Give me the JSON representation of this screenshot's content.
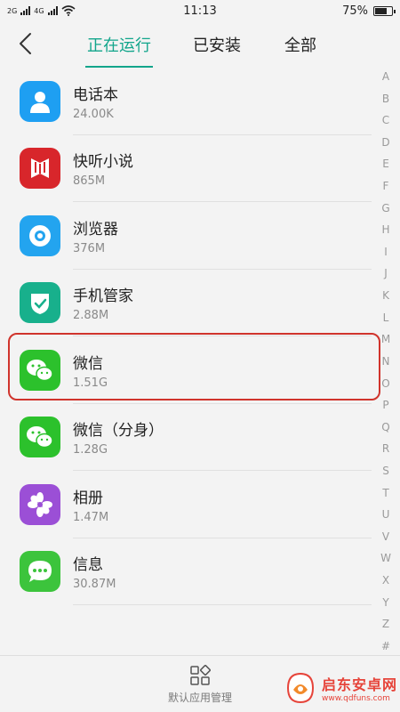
{
  "status_bar": {
    "network1": "2G",
    "network2": "4G",
    "time": "11:13",
    "battery": "75%",
    "battery_level": 0.75
  },
  "header": {
    "tabs": [
      {
        "label": "正在运行",
        "active": true
      },
      {
        "label": "已安装",
        "active": false
      },
      {
        "label": "全部",
        "active": false
      }
    ]
  },
  "apps": [
    {
      "name": "电话本",
      "size": "24.00K",
      "icon": "contacts-icon",
      "color": "#1e9ff2"
    },
    {
      "name": "快听小说",
      "size": "865M",
      "icon": "book-icon",
      "color": "#d8262b"
    },
    {
      "name": "浏览器",
      "size": "376M",
      "icon": "browser-icon",
      "color": "#23a4ef"
    },
    {
      "name": "手机管家",
      "size": "2.88M",
      "icon": "shield-icon",
      "color": "#18b08c"
    },
    {
      "name": "微信",
      "size": "1.51G",
      "icon": "wechat-icon",
      "color": "#2cc12c"
    },
    {
      "name": "微信（分身）",
      "size": "1.28G",
      "icon": "wechat-icon",
      "color": "#2cc12c"
    },
    {
      "name": "相册",
      "size": "1.47M",
      "icon": "photos-icon",
      "color": "#9b4fd6"
    },
    {
      "name": "信息",
      "size": "30.87M",
      "icon": "messages-icon",
      "color": "#3cc43c"
    }
  ],
  "alphabet": [
    "A",
    "B",
    "C",
    "D",
    "E",
    "F",
    "G",
    "H",
    "I",
    "J",
    "K",
    "L",
    "M",
    "N",
    "O",
    "P",
    "Q",
    "R",
    "S",
    "T",
    "U",
    "V",
    "W",
    "X",
    "Y",
    "Z",
    "#"
  ],
  "bottom_bar": {
    "default_apps_label": "默认应用管理"
  },
  "watermark": {
    "title": "启东安卓网",
    "url": "www.qdfuns.com"
  },
  "colors": {
    "accent": "#12a58b",
    "highlight": "#d0342c"
  }
}
